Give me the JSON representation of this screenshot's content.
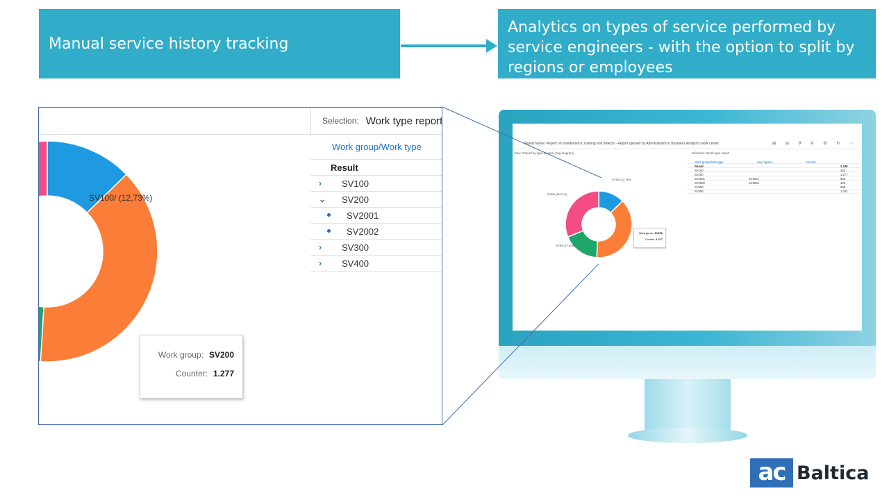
{
  "banners": {
    "left": "Manual service history tracking",
    "right": "Analytics on types of service performed by service engineers - with the option to split by regions or employees"
  },
  "zoom": {
    "selection_label": "Selection:",
    "selection_value": "Work type report",
    "table_header": "Work group/Work type",
    "rows": [
      {
        "label": "Result",
        "kind": "result"
      },
      {
        "label": "SV100",
        "kind": "collapsed"
      },
      {
        "label": "SV200",
        "kind": "expanded"
      },
      {
        "label": "SV2001",
        "kind": "child"
      },
      {
        "label": "SV2002",
        "kind": "child"
      },
      {
        "label": "SV300",
        "kind": "collapsed"
      },
      {
        "label": "SV400",
        "kind": "collapsed"
      }
    ],
    "slice_label": "SV100/ (12,73%)",
    "tooltip": {
      "group_key": "Work group:",
      "group_val": "SV200",
      "counter_key": "Counter:",
      "counter_val": "1.277"
    }
  },
  "screen": {
    "report_title": "Report Name:  Report on maintenance, training and defects - Report opened by Administrator in Business Analytics work center.",
    "toolbar_icons": "⊞ ⊟ ∇ ⚲ ⚙ ↻ ⋯",
    "view_label": "View:",
    "view_value": "Report by type of work (ring diagram)",
    "selection_label": "Selection:",
    "selection_value": "Work type report",
    "columns": [
      "Work group/Work type",
      "Key Figures",
      "Counter"
    ],
    "rows": [
      {
        "c1": "Result",
        "c2": "",
        "c3": "3.338"
      },
      {
        "c1": "SV100",
        "c2": "",
        "c3": "425"
      },
      {
        "c1": "SV200",
        "c2": "",
        "c3": "1.277"
      },
      {
        "c1": "SV2001",
        "c2": "SV2001",
        "c3": "848"
      },
      {
        "c1": "SV2002",
        "c2": "SV2002",
        "c3": "429"
      },
      {
        "c1": "SV300",
        "c2": "",
        "c3": "595"
      },
      {
        "c1": "SV400",
        "c2": "",
        "c3": "1.042"
      }
    ],
    "labels": {
      "sv100": "SV100 (12,73%)",
      "sv400": "SV400 (31,21%)",
      "sv300": "SV300 (17,82%)"
    },
    "tooltip": {
      "group_key": "Work gro.up:",
      "group_val": "SV200",
      "counter_key": "Counter:",
      "counter_val": "1.277"
    }
  },
  "chart_data": {
    "type": "pie",
    "categories": [
      "SV100",
      "SV200",
      "SV300",
      "SV400"
    ],
    "values": [
      425,
      1277,
      595,
      1042
    ],
    "percent_labels": [
      "12,73%",
      "",
      "17,82%",
      "31,21%"
    ],
    "colors": [
      "#1f9ae0",
      "#fb7d37",
      "#1ea56a",
      "#f34d84"
    ]
  },
  "logo": {
    "mark": "ac",
    "text": "Baltica"
  }
}
